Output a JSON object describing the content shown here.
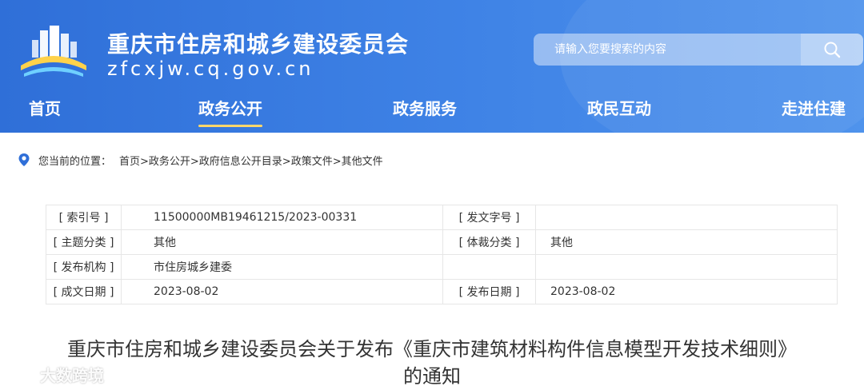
{
  "header": {
    "site_name": "重庆市住房和城乡建设委员会",
    "site_url": "zfcxjw.cq.gov.cn",
    "logo_icon": "building-logo-icon",
    "background_color": "#3a7be2"
  },
  "search": {
    "placeholder": "请输入您要搜索的内容",
    "icon": "search-icon"
  },
  "nav": {
    "items": [
      {
        "label": "首页",
        "active": false
      },
      {
        "label": "政务公开",
        "active": true
      },
      {
        "label": "政务服务",
        "active": false
      },
      {
        "label": "政民互动",
        "active": false
      },
      {
        "label": "走进住建",
        "active": false
      }
    ],
    "active_underline_color": "#ffd76a"
  },
  "breadcrumb": {
    "icon": "location-pin-icon",
    "label": "您当前的位置：",
    "path": "首页>政务公开>政府信息公开目录>政策文件>其他文件"
  },
  "meta": {
    "rows": [
      {
        "k1": "[ 索引号 ]",
        "v1": "11500000MB19461215/2023-00331",
        "k2": "[ 发文字号 ]",
        "v2": ""
      },
      {
        "k1": "[ 主题分类 ]",
        "v1": "其他",
        "k2": "[ 体裁分类 ]",
        "v2": "其他"
      },
      {
        "k1": "[ 发布机构 ]",
        "v1": "市住房城乡建委",
        "k2": "",
        "v2": ""
      },
      {
        "k1": "[ 成文日期 ]",
        "v1": "2023-08-02",
        "k2": "[ 发布日期 ]",
        "v2": "2023-08-02"
      }
    ]
  },
  "article": {
    "title_line1": "重庆市住房和城乡建设委员会关于发布《重庆市建筑材料构件信息模型开发技术细则》",
    "title_line2": "的通知"
  },
  "watermark": {
    "text": "大数跨境",
    "icon": "weibo-icon"
  }
}
